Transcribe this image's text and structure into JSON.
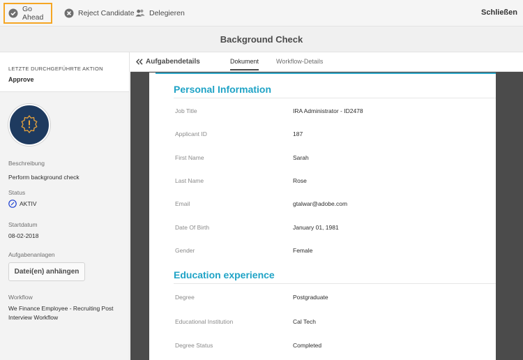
{
  "toolbar": {
    "go_ahead": "Go Ahead",
    "reject": "Reject Candidate",
    "delegate": "Delegieren",
    "close": "Schließen"
  },
  "title": "Background Check",
  "sidebar": {
    "last_action_label": "LETZTE DURCHGEFÜHRTE AKTION",
    "last_action_value": "Approve",
    "description_label": "Beschreibung",
    "description_value": "Perform background check",
    "status_label": "Status",
    "status_value": "AKTIV",
    "start_label": "Startdatum",
    "start_value": "08-02-2018",
    "attachments_label": "Aufgabenanlagen",
    "attach_button": "Datei(en) anhängen",
    "workflow_label": "Workflow",
    "workflow_value": "We Finance Employee - Recruiting Post Interview Workflow"
  },
  "tabs": {
    "back": "Aufgabendetails",
    "document": "Dokument",
    "workflow_details": "Workflow-Details"
  },
  "document": {
    "personal_title": "Personal Information",
    "personal_fields": [
      {
        "label": "Job Title",
        "value": "IRA Administrator - ID2478"
      },
      {
        "label": "Applicant ID",
        "value": "187"
      },
      {
        "label": "First Name",
        "value": "Sarah"
      },
      {
        "label": "Last Name",
        "value": "Rose"
      },
      {
        "label": "Email",
        "value": "gtalwar@adobe.com"
      },
      {
        "label": "Date Of Birth",
        "value": "January 01, 1981"
      },
      {
        "label": "Gender",
        "value": "Female"
      }
    ],
    "education_title": "Education experience",
    "education_fields": [
      {
        "label": "Degree",
        "value": "Postgraduate"
      },
      {
        "label": "Educational Institution",
        "value": "Cal Tech"
      },
      {
        "label": "Degree Status",
        "value": "Completed"
      }
    ]
  },
  "colors": {
    "accent_blue": "#1fa3c6",
    "highlight_orange": "#f5a623",
    "avatar_navy": "#1e3a5f"
  },
  "icons": {
    "go_ahead": "check-circle-icon",
    "reject": "x-circle-icon",
    "delegate": "users-icon",
    "back": "double-chevron-left-icon",
    "status": "clock-icon",
    "avatar": "alert-badge-icon"
  }
}
